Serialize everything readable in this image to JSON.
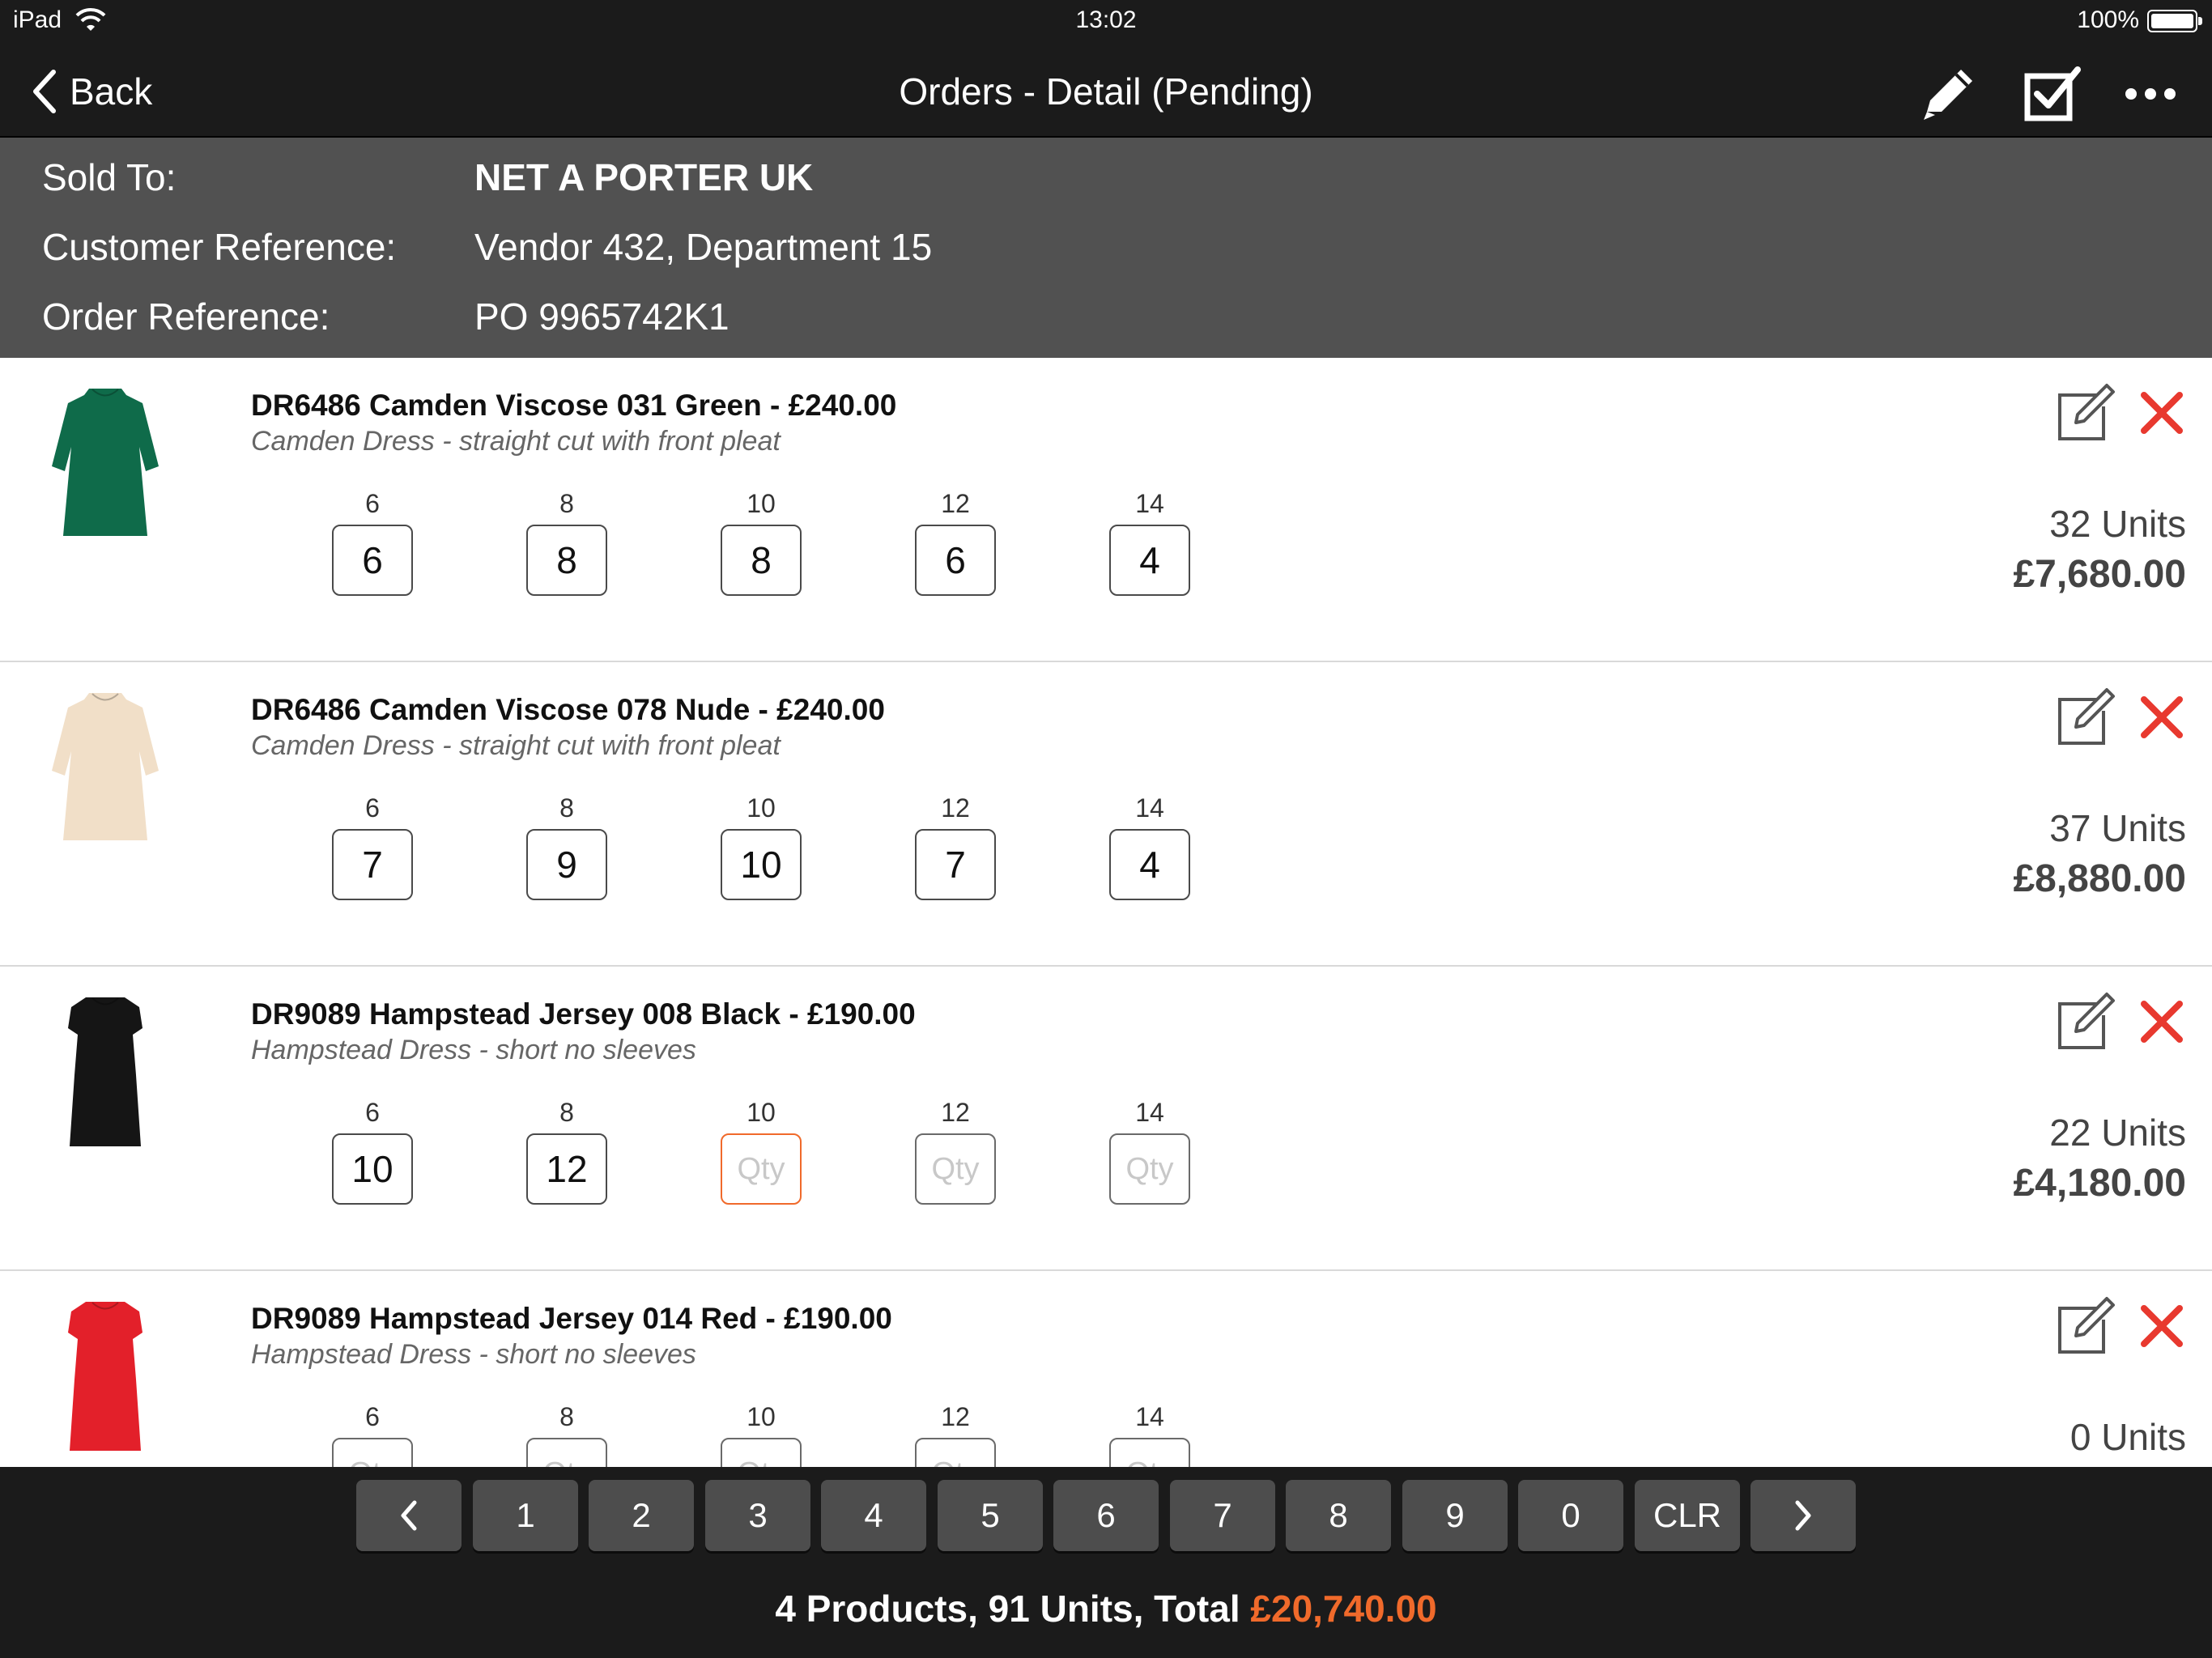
{
  "status_bar": {
    "device": "iPad",
    "time": "13:02",
    "battery": "100%"
  },
  "nav": {
    "back_label": "Back",
    "title": "Orders - Detail (Pending)"
  },
  "header": {
    "sold_to_label": "Sold To:",
    "sold_to_value": "NET A PORTER UK",
    "customer_ref_label": "Customer Reference:",
    "customer_ref_value": "Vendor 432, Department 15",
    "order_ref_label": "Order Reference:",
    "order_ref_value": "PO 9965742K1"
  },
  "qty_placeholder": "Qty",
  "items": [
    {
      "title": "DR6486 Camden Viscose 031 Green - £240.00",
      "subtitle": "Camden Dress - straight cut with front pleat",
      "dress_color": "#0f6b4a",
      "dress_style": "loose",
      "sizes": [
        {
          "label": "6",
          "qty": "6"
        },
        {
          "label": "8",
          "qty": "8"
        },
        {
          "label": "10",
          "qty": "8"
        },
        {
          "label": "12",
          "qty": "6"
        },
        {
          "label": "14",
          "qty": "4"
        }
      ],
      "units": "32 Units",
      "total": "£7,680.00"
    },
    {
      "title": "DR6486 Camden Viscose 078 Nude - £240.00",
      "subtitle": "Camden Dress - straight cut with front pleat",
      "dress_color": "#f1dfc8",
      "dress_style": "loose",
      "sizes": [
        {
          "label": "6",
          "qty": "7"
        },
        {
          "label": "8",
          "qty": "9"
        },
        {
          "label": "10",
          "qty": "10"
        },
        {
          "label": "12",
          "qty": "7"
        },
        {
          "label": "14",
          "qty": "4"
        }
      ],
      "units": "37 Units",
      "total": "£8,880.00"
    },
    {
      "title": "DR9089 Hampstead Jersey 008 Black - £190.00",
      "subtitle": "Hampstead Dress - short no sleeves",
      "dress_color": "#151515",
      "dress_style": "fitted",
      "sizes": [
        {
          "label": "6",
          "qty": "10"
        },
        {
          "label": "8",
          "qty": "12"
        },
        {
          "label": "10",
          "qty": "",
          "active": true
        },
        {
          "label": "12",
          "qty": ""
        },
        {
          "label": "14",
          "qty": ""
        }
      ],
      "units": "22 Units",
      "total": "£4,180.00"
    },
    {
      "title": "DR9089 Hampstead Jersey 014 Red - £190.00",
      "subtitle": "Hampstead Dress - short no sleeves",
      "dress_color": "#e3202a",
      "dress_style": "fitted",
      "sizes": [
        {
          "label": "6",
          "qty": ""
        },
        {
          "label": "8",
          "qty": ""
        },
        {
          "label": "10",
          "qty": ""
        },
        {
          "label": "12",
          "qty": ""
        },
        {
          "label": "14",
          "qty": ""
        }
      ],
      "units": "0 Units",
      "total": ""
    }
  ],
  "keypad": {
    "prev_icon": "chevron-left-icon",
    "next_icon": "chevron-right-icon",
    "keys": [
      "1",
      "2",
      "3",
      "4",
      "5",
      "6",
      "7",
      "8",
      "9",
      "0",
      "CLR"
    ]
  },
  "summary": {
    "text": "4 Products, 91 Units, Total ",
    "total": "£20,740.00"
  },
  "colors": {
    "accent": "#f06a2b",
    "delete": "#e8392f",
    "bar": "#1b1b1b",
    "header_bg": "#515151"
  }
}
